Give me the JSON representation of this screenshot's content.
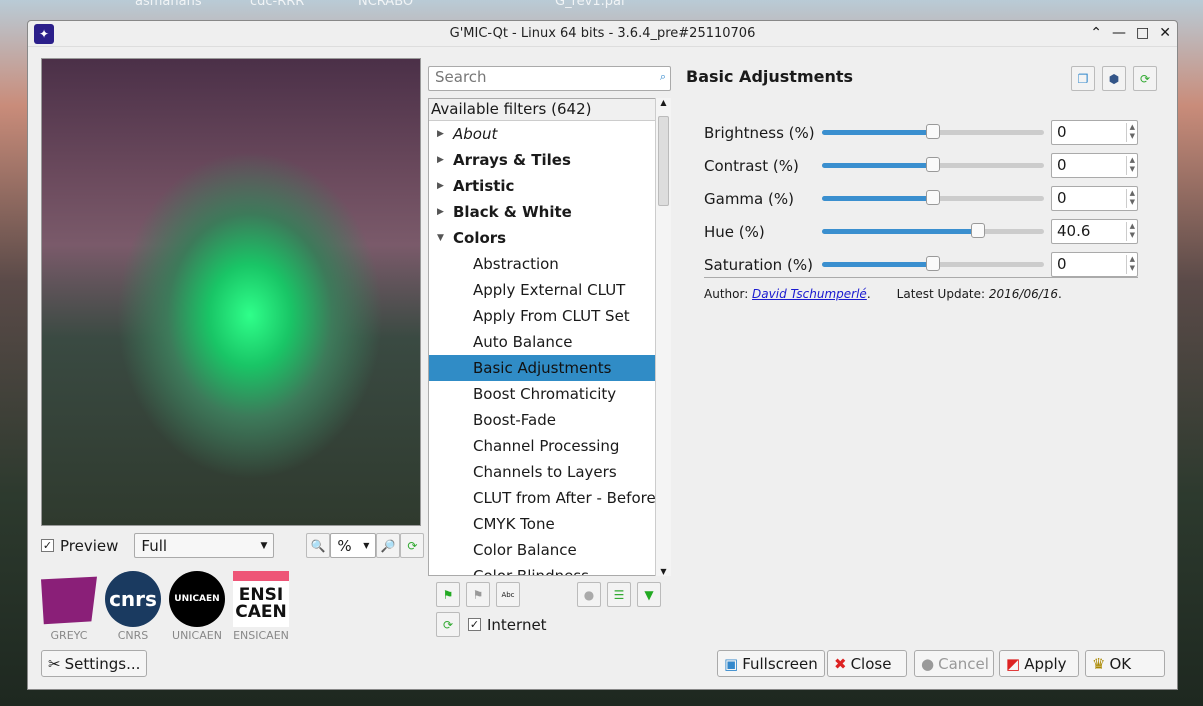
{
  "desktop": {
    "labels": [
      "asmahans",
      "cdc-RRR",
      "NCRABO",
      "G_rev1.pai"
    ]
  },
  "window": {
    "title": "G'MIC-Qt - Linux 64 bits - 3.6.4_pre#25110706"
  },
  "preview": {
    "checkbox_label": "Preview",
    "checked": true,
    "mode": "Full",
    "zoom_label": "%"
  },
  "logos": [
    "GREYC",
    "CNRS",
    "UNICAEN",
    "ENSICAEN"
  ],
  "logo_text": {
    "cnrs": "cnrs",
    "unicaen": "UNICAEN",
    "ensicaen": "ENSI CAEN"
  },
  "settings_label": "Settings...",
  "filters": {
    "search_placeholder": "Search",
    "header": "Available filters (642)",
    "items": [
      {
        "label": "About",
        "type": "cat-italic"
      },
      {
        "label": "Arrays & Tiles",
        "type": "cat"
      },
      {
        "label": "Artistic",
        "type": "cat"
      },
      {
        "label": "Black & White",
        "type": "cat"
      },
      {
        "label": "Colors",
        "type": "cat-open"
      },
      {
        "label": "Abstraction",
        "type": "child"
      },
      {
        "label": "Apply External CLUT",
        "type": "child"
      },
      {
        "label": "Apply From CLUT Set",
        "type": "child"
      },
      {
        "label": "Auto Balance",
        "type": "child"
      },
      {
        "label": "Basic Adjustments",
        "type": "child-selected"
      },
      {
        "label": "Boost Chromaticity",
        "type": "child"
      },
      {
        "label": "Boost-Fade",
        "type": "child"
      },
      {
        "label": "Channel Processing",
        "type": "child"
      },
      {
        "label": "Channels to Layers",
        "type": "child"
      },
      {
        "label": "CLUT from After - Before",
        "type": "child"
      },
      {
        "label": "CMYK Tone",
        "type": "child"
      },
      {
        "label": "Color Balance",
        "type": "child"
      },
      {
        "label": "Color Blindness",
        "type": "child"
      }
    ],
    "internet_label": "Internet",
    "internet_checked": true
  },
  "filter_panel": {
    "title": "Basic Adjustments",
    "params": [
      {
        "label": "Brightness (%)",
        "value": "0",
        "fraction": 0.5
      },
      {
        "label": "Contrast (%)",
        "value": "0",
        "fraction": 0.5
      },
      {
        "label": "Gamma (%)",
        "value": "0",
        "fraction": 0.5
      },
      {
        "label": "Hue (%)",
        "value": "40.6",
        "fraction": 0.703
      },
      {
        "label": "Saturation (%)",
        "value": "0",
        "fraction": 0.5
      }
    ],
    "author_prefix": "Author: ",
    "author": "David Tschumperlé",
    "update_prefix": "Latest Update: ",
    "update": "2016/06/16"
  },
  "buttons": {
    "fullscreen": "Fullscreen",
    "close": "Close",
    "cancel": "Cancel",
    "apply": "Apply",
    "ok": "OK"
  }
}
